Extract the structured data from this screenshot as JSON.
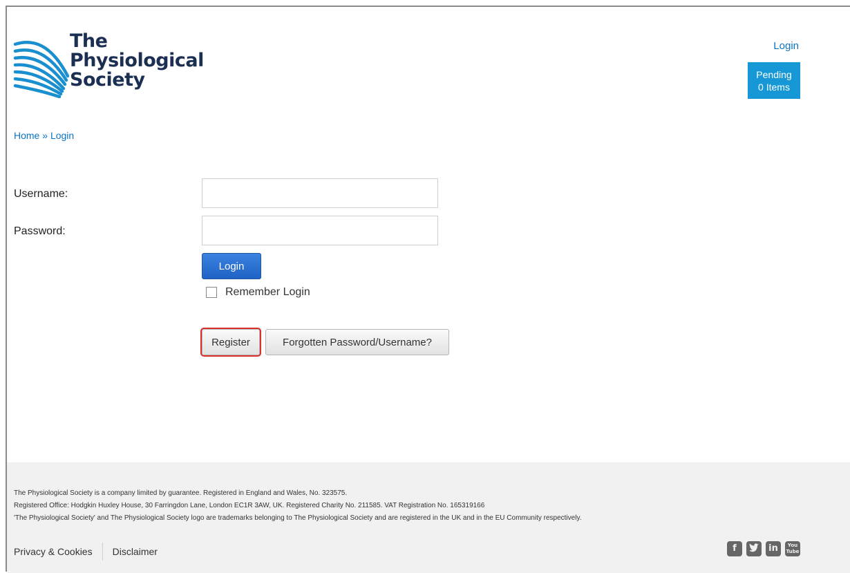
{
  "header": {
    "logo_lines": [
      "The",
      "Physiological",
      "Society"
    ],
    "login_link": "Login",
    "pending_line1": "Pending",
    "pending_line2": "0 Items"
  },
  "breadcrumb": {
    "home": "Home",
    "separator": "»",
    "current": "Login"
  },
  "form": {
    "username_label": "Username:",
    "username_value": "",
    "password_label": "Password:",
    "password_value": "",
    "login_button": "Login",
    "remember_label": "Remember Login",
    "remember_checked": false,
    "register_button": "Register",
    "forgot_button": "Forgotten Password/Username?"
  },
  "footer": {
    "legal_line1": "The Physiological Society is a company limited by guarantee. Registered in England and Wales, No. 323575.",
    "legal_line2": "Registered Office: Hodgkin Huxley House, 30 Farringdon Lane, London EC1R 3AW, UK. Registered Charity No. 211585. VAT Registration No. 165319166",
    "legal_line3": "'The Physiological Society' and The Physiological Society logo are trademarks belonging to The Physiological Society and are registered in the UK and in the EU Community respectively.",
    "privacy_link": "Privacy & Cookies",
    "disclaimer_link": "Disclaimer",
    "social_icons": [
      "facebook-icon",
      "twitter-icon",
      "linkedin-icon",
      "youtube-icon"
    ]
  },
  "colors": {
    "link_blue": "#0a74c4",
    "pending_bg": "#1798d6",
    "logo_navy": "#1b2f52",
    "logo_teal": "#1a8fd0",
    "highlight_red": "#d9302a"
  }
}
